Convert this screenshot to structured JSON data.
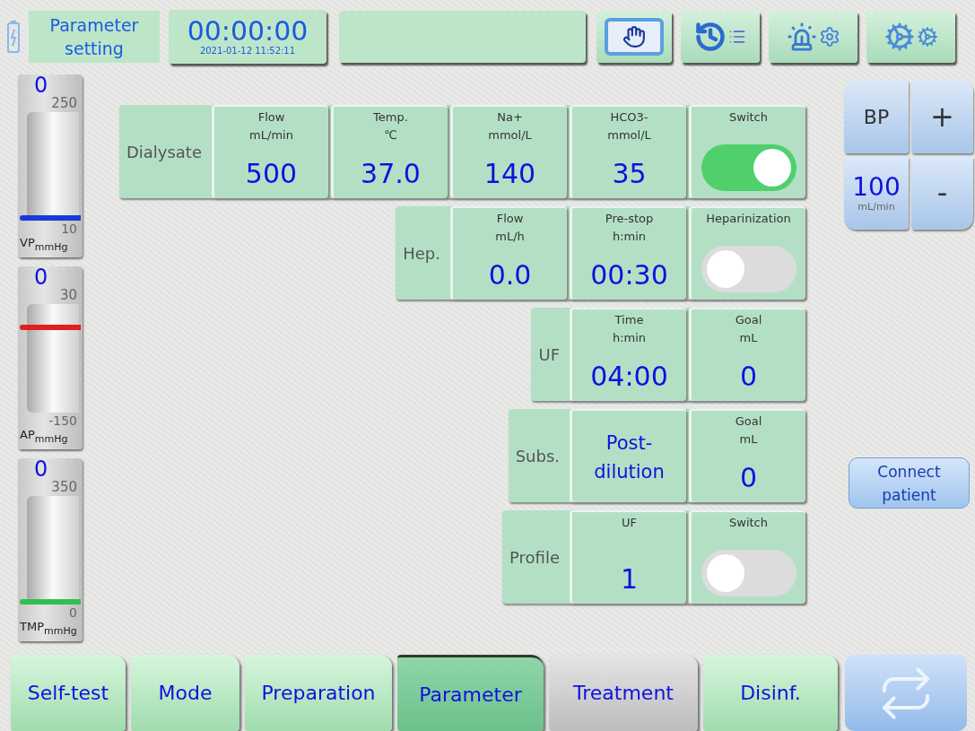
{
  "header": {
    "title": "Parameter setting",
    "timer": "00:00:00",
    "datetime": "2021-01-12 11:52:11"
  },
  "gauges": [
    {
      "value": "0",
      "upper": "250",
      "lower": "10",
      "name": "VP$_{mmHg}$",
      "level": 0.0,
      "color": "#1a3ad8"
    },
    {
      "value": "0",
      "upper": "30",
      "lower": "-150",
      "name": "AP$_{mmHg}$",
      "level": 0.8,
      "color": "#e02020"
    },
    {
      "value": "0",
      "upper": "350",
      "lower": "0",
      "name": "TMP$_{mmHg}$",
      "level": 0.0,
      "color": "#2ec050"
    }
  ],
  "sections": [
    {
      "label": "Dialysate",
      "cells": [
        {
          "kind": "value",
          "caption": "Flow",
          "unit": "mL/min",
          "value": "500"
        },
        {
          "kind": "value",
          "caption": "Temp.",
          "unit": "℃",
          "value": "37.0"
        },
        {
          "kind": "value",
          "caption": "Na+",
          "unit": "mmol/L",
          "value": "140"
        },
        {
          "kind": "value",
          "caption": "HCO3-",
          "unit": "mmol/L",
          "value": "35"
        },
        {
          "kind": "switch",
          "caption": "Switch",
          "on": true
        }
      ]
    },
    {
      "label": "Hep.",
      "cells": [
        {
          "kind": "value",
          "caption": "Flow",
          "unit": "mL/h",
          "value": "0.0"
        },
        {
          "kind": "value",
          "caption": "Pre-stop",
          "unit": "h:min",
          "value": "00:30"
        },
        {
          "kind": "switch",
          "caption": "Heparinization",
          "on": false
        }
      ]
    },
    {
      "label": "UF",
      "cells": [
        {
          "kind": "value",
          "caption": "Time",
          "unit": "h:min",
          "value": "04:00"
        },
        {
          "kind": "value",
          "caption": "Goal",
          "unit": "mL",
          "value": "0"
        }
      ]
    },
    {
      "label": "Subs.",
      "cells": [
        {
          "kind": "text",
          "value": "Post-dilution"
        },
        {
          "kind": "value",
          "caption": "Goal",
          "unit": "mL",
          "value": "0"
        }
      ]
    },
    {
      "label": "Profile",
      "cells": [
        {
          "kind": "value",
          "caption": "UF",
          "value": "1"
        },
        {
          "kind": "switch",
          "caption": "Switch",
          "on": false
        }
      ]
    }
  ],
  "bp": {
    "label": "BP",
    "value": "100",
    "unit": "mL/min",
    "plus": "+",
    "minus": "-"
  },
  "connect_button": "Connect patient",
  "tabs": [
    {
      "label": "Self-test",
      "selected": false,
      "disabled": false
    },
    {
      "label": "Mode",
      "selected": false,
      "disabled": false
    },
    {
      "label": "Preparation",
      "selected": false,
      "disabled": false
    },
    {
      "label": "Parameter",
      "selected": true,
      "disabled": false
    },
    {
      "label": "Treatment",
      "selected": false,
      "disabled": true
    },
    {
      "label": "Disinf.",
      "selected": false,
      "disabled": false
    }
  ]
}
